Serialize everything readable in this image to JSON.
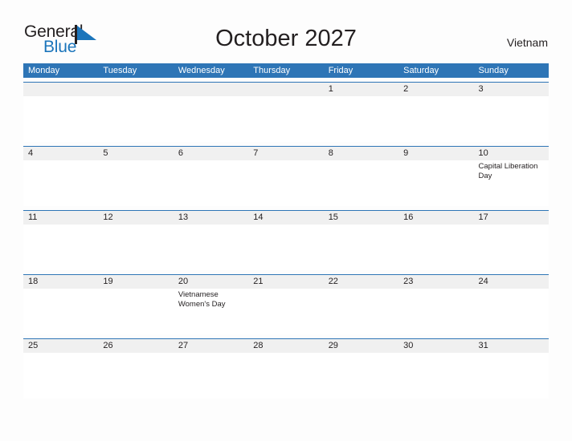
{
  "brand": {
    "name_part1": "General",
    "name_part2": "Blue",
    "mark": "triangle-flag-icon",
    "accent_color": "#1b75bb"
  },
  "header": {
    "title": "October 2027",
    "region": "Vietnam"
  },
  "calendar": {
    "header_color": "#2e75b6",
    "datebar_color": "#f0f0f0",
    "weekdays": [
      "Monday",
      "Tuesday",
      "Wednesday",
      "Thursday",
      "Friday",
      "Saturday",
      "Sunday"
    ],
    "weeks": [
      {
        "days": [
          {
            "num": "",
            "event": ""
          },
          {
            "num": "",
            "event": ""
          },
          {
            "num": "",
            "event": ""
          },
          {
            "num": "",
            "event": ""
          },
          {
            "num": "1",
            "event": ""
          },
          {
            "num": "2",
            "event": ""
          },
          {
            "num": "3",
            "event": ""
          }
        ]
      },
      {
        "days": [
          {
            "num": "4",
            "event": ""
          },
          {
            "num": "5",
            "event": ""
          },
          {
            "num": "6",
            "event": ""
          },
          {
            "num": "7",
            "event": ""
          },
          {
            "num": "8",
            "event": ""
          },
          {
            "num": "9",
            "event": ""
          },
          {
            "num": "10",
            "event": "Capital Liberation Day"
          }
        ]
      },
      {
        "days": [
          {
            "num": "11",
            "event": ""
          },
          {
            "num": "12",
            "event": ""
          },
          {
            "num": "13",
            "event": ""
          },
          {
            "num": "14",
            "event": ""
          },
          {
            "num": "15",
            "event": ""
          },
          {
            "num": "16",
            "event": ""
          },
          {
            "num": "17",
            "event": ""
          }
        ]
      },
      {
        "days": [
          {
            "num": "18",
            "event": ""
          },
          {
            "num": "19",
            "event": ""
          },
          {
            "num": "20",
            "event": "Vietnamese Women's Day"
          },
          {
            "num": "21",
            "event": ""
          },
          {
            "num": "22",
            "event": ""
          },
          {
            "num": "23",
            "event": ""
          },
          {
            "num": "24",
            "event": ""
          }
        ]
      },
      {
        "days": [
          {
            "num": "25",
            "event": ""
          },
          {
            "num": "26",
            "event": ""
          },
          {
            "num": "27",
            "event": ""
          },
          {
            "num": "28",
            "event": ""
          },
          {
            "num": "29",
            "event": ""
          },
          {
            "num": "30",
            "event": ""
          },
          {
            "num": "31",
            "event": ""
          }
        ]
      }
    ]
  }
}
